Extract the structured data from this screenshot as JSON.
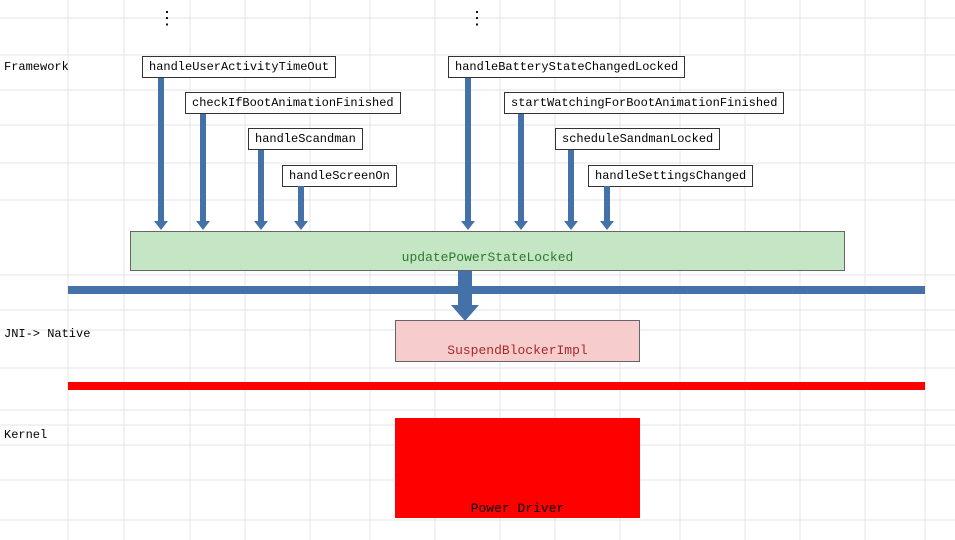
{
  "layers": {
    "framework": "Framework",
    "jni": "JNI-> Native",
    "kernel": "Kernel"
  },
  "boxes_left": [
    "handleUserActivityTimeOut",
    "checkIfBootAnimationFinished",
    "handleScandman",
    "handleScreenOn"
  ],
  "boxes_right": [
    "handleBatteryStateChangedLocked",
    "startWatchingForBootAnimationFinished",
    "scheduleSandmanLocked",
    "handleSettingsChanged"
  ],
  "green": "updatePowerStateLocked",
  "pink": "SuspendBlockerImpl",
  "red": "Power Driver",
  "dots": "⋮"
}
